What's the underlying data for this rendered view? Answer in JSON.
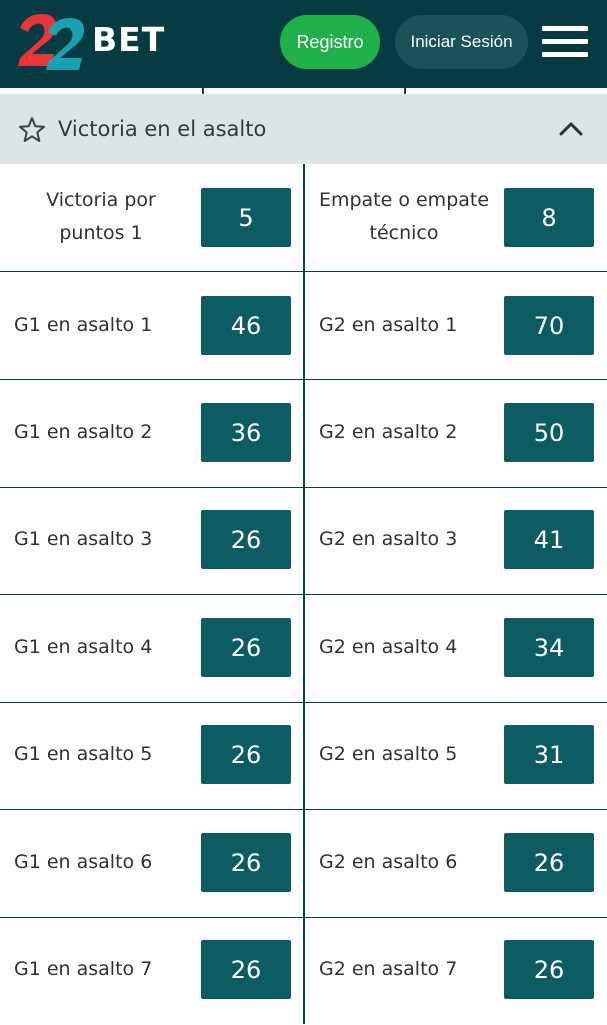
{
  "header": {
    "logo_text": "BET",
    "logo_number": "22",
    "register_label": "Registro",
    "login_label": "Iniciar Sesión"
  },
  "section": {
    "title": "Victoria en el asalto"
  },
  "markets": [
    {
      "left_label": "Victoria por puntos 1",
      "left_odd": "5",
      "right_label": "Empate o empate técnico",
      "right_odd": "8"
    },
    {
      "left_label": "G1 en asalto 1",
      "left_odd": "46",
      "right_label": "G2 en asalto 1",
      "right_odd": "70"
    },
    {
      "left_label": "G1 en asalto 2",
      "left_odd": "36",
      "right_label": "G2 en asalto 2",
      "right_odd": "50"
    },
    {
      "left_label": "G1 en asalto 3",
      "left_odd": "26",
      "right_label": "G2 en asalto 3",
      "right_odd": "41"
    },
    {
      "left_label": "G1 en asalto 4",
      "left_odd": "26",
      "right_label": "G2 en asalto 4",
      "right_odd": "34"
    },
    {
      "left_label": "G1 en asalto 5",
      "left_odd": "26",
      "right_label": "G2 en asalto 5",
      "right_odd": "31"
    },
    {
      "left_label": "G1 en asalto 6",
      "left_odd": "26",
      "right_label": "G2 en asalto 6",
      "right_odd": "26"
    },
    {
      "left_label": "G1 en asalto 7",
      "left_odd": "26",
      "right_label": "G2 en asalto 7",
      "right_odd": "26"
    }
  ],
  "colors": {
    "header_bg": "#053b41",
    "register_green": "#21b14b",
    "odd_bg": "#0d5c63",
    "logo_red": "#e8363c",
    "logo_teal": "#1aa6b7"
  },
  "icons": {
    "favorite": "star-icon",
    "collapse": "chevron-up-icon",
    "menu": "hamburger-menu-icon"
  }
}
